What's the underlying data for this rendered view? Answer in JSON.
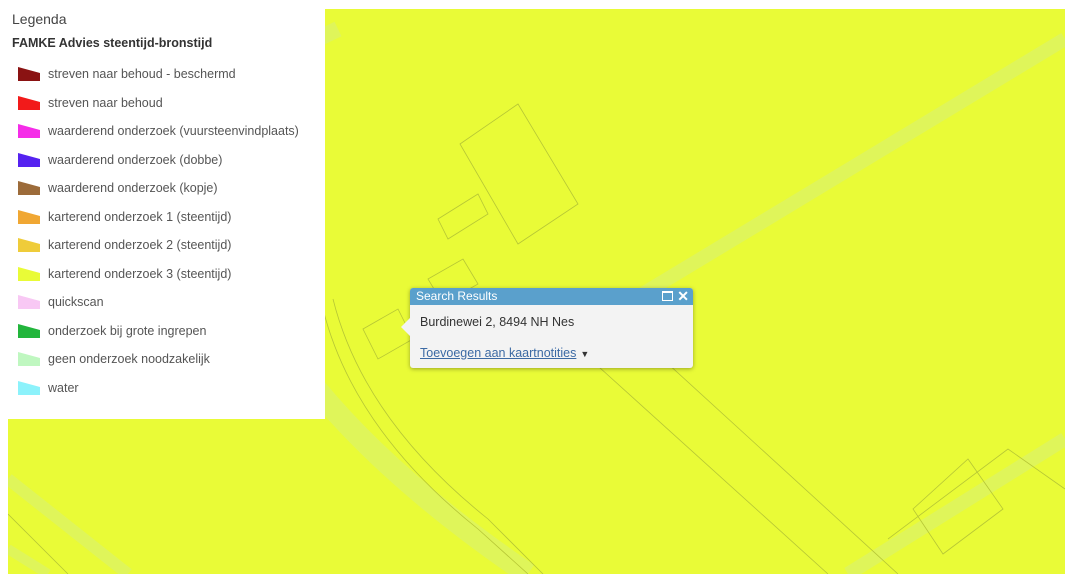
{
  "map": {
    "fill_color": "#e9fb37",
    "line_color": "#b6c635",
    "road_color": "#dff55a"
  },
  "legend": {
    "title": "Legenda",
    "layer_name": "FAMKE Advies steentijd-bronstijd",
    "items": [
      {
        "label": "streven naar behoud - beschermd",
        "color": "#8a1212"
      },
      {
        "label": "streven naar behoud",
        "color": "#f21a1a"
      },
      {
        "label": "waarderend onderzoek (vuursteenvindplaats)",
        "color": "#f52ce8"
      },
      {
        "label": "waarderend onderzoek (dobbe)",
        "color": "#5522f0"
      },
      {
        "label": "waarderend onderzoek (kopje)",
        "color": "#9c6b3a"
      },
      {
        "label": "karterend onderzoek 1 (steentijd)",
        "color": "#f0a733"
      },
      {
        "label": "karterend onderzoek 2 (steentijd)",
        "color": "#efcc3a"
      },
      {
        "label": "karterend onderzoek 3 (steentijd)",
        "color": "#e9fb37"
      },
      {
        "label": "quickscan",
        "color": "#f8c8f4"
      },
      {
        "label": "onderzoek bij grote ingrepen",
        "color": "#22b53c"
      },
      {
        "label": "geen onderzoek noodzakelijk",
        "color": "#bff7c0"
      },
      {
        "label": "water",
        "color": "#8cf2fb"
      }
    ]
  },
  "popup": {
    "title": "Search Results",
    "address": "Burdinewei 2, 8494 NH Nes",
    "link_label": "Toevoegen aan kaartnotities",
    "caret": "▼",
    "close_glyph": "✕"
  }
}
